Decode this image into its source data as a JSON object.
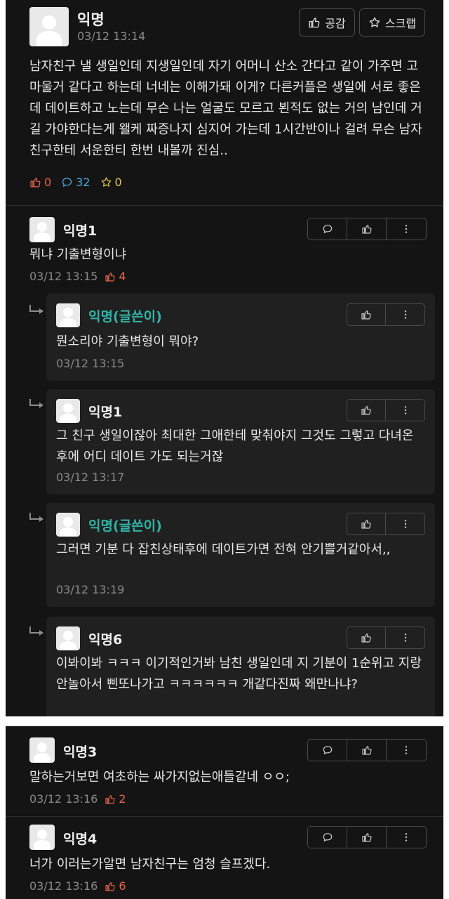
{
  "post": {
    "author": "익명",
    "time": "03/12 13:14",
    "like_button_label": "공감",
    "scrap_button_label": "스크랩",
    "body": "남자친구 낼 생일인데 지생일인데 자기 어머니 산소 간다고 같이 가주면 고마울거 같다고 하는데 너네는 이해가돼 이게? 다른커플은 생일에 서로 좋은데 데이트하고 노는데 무슨 나는 얼굴도 모르고 뵌적도 없는 거의 남인데 거길 가야한다는게 왤케 짜증나지 심지어 가는데 1시간반이나 걸려 무슨 남자친구한테 서운한티 한번 내볼까 진심..",
    "likes": "0",
    "comments": "32",
    "scraps": "0"
  },
  "comments": [
    {
      "author": "익명1",
      "text": "뭐냐 기출변형이냐",
      "time": "03/12 13:15",
      "likes": "4"
    }
  ],
  "replies": [
    {
      "author": "익명(글쓴이)",
      "text": "뭔소리야 기출변형이 뭐야?",
      "time": "03/12 13:15"
    },
    {
      "author": "익명1",
      "text": "그 친구 생일이잖아 최대한 그애한테 맞춰야지 그것도 그렇고 다녀온 후에 어디 데이트 가도 되는거잖",
      "time": "03/12 13:17"
    },
    {
      "author": "익명(글쓴이)",
      "text": "그러면 기분 다 잡친상태후에 데이트가면 전혀 안기쁠거같아서,,",
      "time": "03/12 13:19"
    },
    {
      "author": "익명6",
      "text": "이봐이봐 ㅋㅋㅋ 이기적인거봐 남친 생일인데 지 기분이 1순위고 지랑 안놀아서 삔또나가고 ㅋㅋㅋㅋㅋㅋ 개같다진짜 왜만나냐?"
    }
  ],
  "comments2": [
    {
      "author": "익명3",
      "text": "말하는거보면 여초하는 싸가지없는애들같네 ㅇㅇ;",
      "time": "03/12 13:16",
      "likes": "2"
    },
    {
      "author": "익명4",
      "text": "너가 이러는가알면 남자친구는 엄청 슬프겠다.",
      "time": "03/12 13:16",
      "likes": "6"
    }
  ],
  "colors": {
    "background": "#141414",
    "author_accent": "#2fb5a8",
    "like_accent": "#e8654a",
    "comment_accent": "#4aa8e0",
    "reply_box": "#202020"
  },
  "icons": [
    "thumbs-up-icon",
    "star-icon",
    "chat-bubble-icon",
    "more-vertical-icon",
    "reply-arrow-icon"
  ]
}
